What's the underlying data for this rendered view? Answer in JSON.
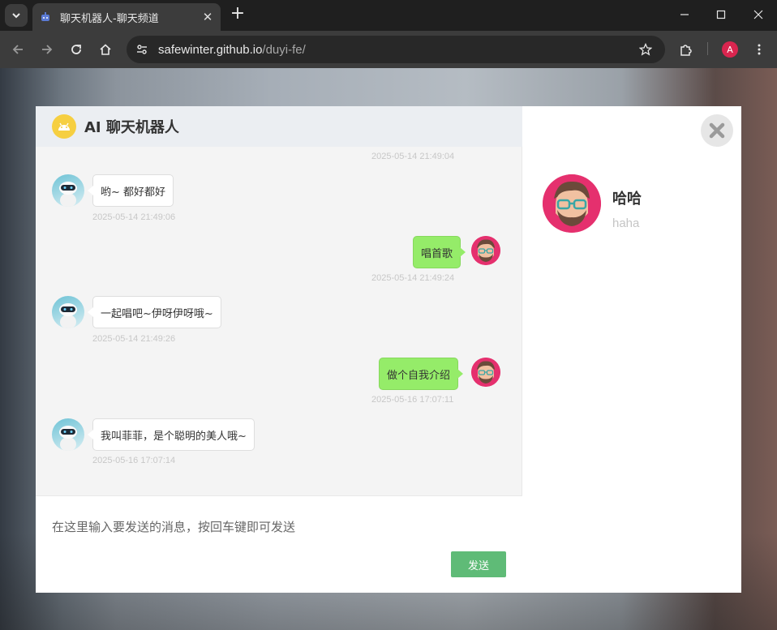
{
  "browser": {
    "tab_title": "聊天机器人-聊天频道",
    "url_host": "safewinter.github.io",
    "url_path": "/duyi-fe/",
    "profile_initial": "A"
  },
  "chat": {
    "title": "AI 聊天机器人",
    "top_timestamp": "2025-05-14 21:49:04",
    "messages": [
      {
        "from": "bot",
        "text": "哟~ 都好都好",
        "time": "2025-05-14 21:49:06"
      },
      {
        "from": "user",
        "text": "唱首歌",
        "time": "2025-05-14 21:49:24"
      },
      {
        "from": "bot",
        "text": "一起唱吧~伊呀伊呀哦~",
        "time": "2025-05-14 21:49:26"
      },
      {
        "from": "user",
        "text": "做个自我介绍",
        "time": "2025-05-16 17:07:11"
      },
      {
        "from": "bot",
        "text": "我叫菲菲，是个聪明的美人哦~",
        "time": "2025-05-16 17:07:14"
      }
    ],
    "input_placeholder": "在这里输入要发送的消息，按回车键即可发送",
    "send_label": "发送"
  },
  "profile": {
    "name": "哈哈",
    "login_id": "haha"
  },
  "colors": {
    "user_bubble": "#95ec69",
    "send_button": "#5fbb77",
    "avatar_bg": "#e5306e"
  }
}
